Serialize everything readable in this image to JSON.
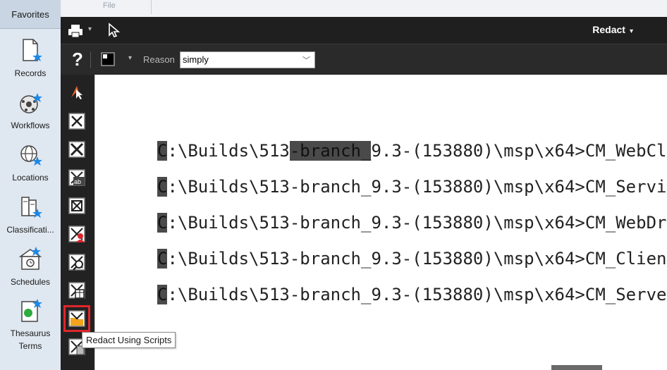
{
  "sidebar": {
    "header": "Favorites",
    "items": [
      {
        "label": "Records",
        "icon": "records-icon"
      },
      {
        "label": "Workflows",
        "icon": "workflows-icon"
      },
      {
        "label": "Locations",
        "icon": "locations-icon"
      },
      {
        "label": "Classificati...",
        "icon": "classifications-icon"
      },
      {
        "label": "Schedules",
        "icon": "schedules-icon"
      },
      {
        "label": "Thesaurus",
        "label2": "Terms",
        "icon": "thesaurus-icon"
      }
    ]
  },
  "topstrip": {
    "file_label": "File"
  },
  "toolbar": {
    "redact_menu": "Redact",
    "reason_label": "Reason",
    "reason_value": "simply"
  },
  "tools": [
    "pointer-tool",
    "redact-area-tool",
    "redact-region-tool",
    "redact-text-tool",
    "redact-page-tool",
    "redact-person-tool",
    "redact-search-tool",
    "redact-table-tool",
    "redact-using-scripts-tool",
    "redact-document-tool"
  ],
  "document": {
    "lines": [
      {
        "a": "C",
        "b": ":\\Builds\\513",
        "c": "-branch_",
        "d": "9.3-(153880)\\msp\\x64>CM_WebCl"
      },
      {
        "a": "C",
        "b": ":\\Builds\\513-branch_9.3-(153880)\\msp\\x64>CM_Servi"
      },
      {
        "a": "C",
        "b": ":\\Builds\\513-branch_9.3-(153880)\\msp\\x64>CM_WebDr"
      },
      {
        "a": "C",
        "b": ":\\Builds\\513-branch_9.3-(153880)\\msp\\x64>CM_Clien"
      },
      {
        "a": "C",
        "b": ":\\Builds\\513-branch_9.3-(153880)\\msp\\x64>CM_Serve"
      }
    ]
  },
  "tooltip": "Redact Using Scripts",
  "colors": {
    "toolbar_dark": "#1f1f1f",
    "selection_red": "#e0262b",
    "sidebar_bg": "#dfe7f0",
    "accent_blue": "#1e88e5"
  }
}
